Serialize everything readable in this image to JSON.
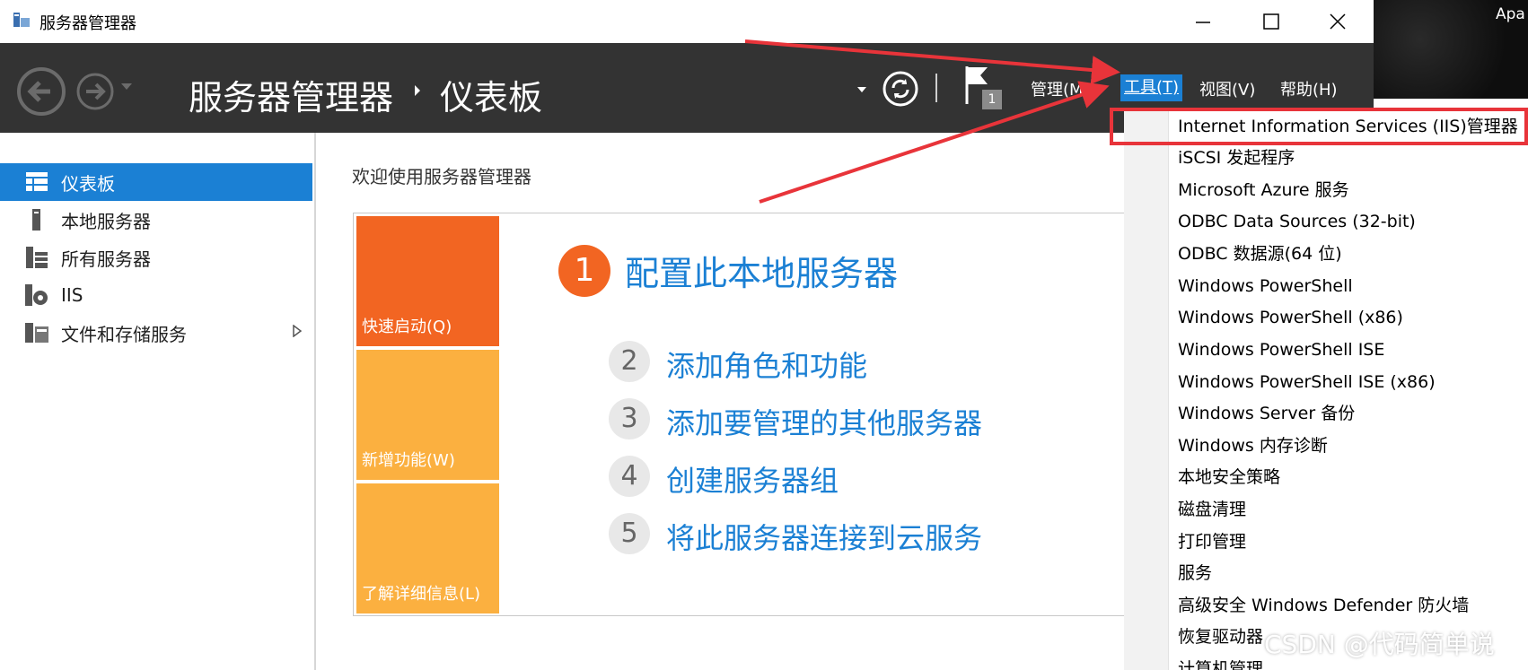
{
  "window": {
    "title": "服务器管理器",
    "corner_text": "Apa"
  },
  "header": {
    "breadcrumb_root": "服务器管理器",
    "breadcrumb_current": "仪表板",
    "notification_count": "1",
    "menus": {
      "manage": "管理(M)",
      "tools": "工具(T)",
      "view": "视图(V)",
      "help": "帮助(H)"
    }
  },
  "sidebar": {
    "items": [
      {
        "label": "仪表板",
        "icon": "dashboard-icon",
        "active": true
      },
      {
        "label": "本地服务器",
        "icon": "server-icon"
      },
      {
        "label": "所有服务器",
        "icon": "servers-icon"
      },
      {
        "label": "IIS",
        "icon": "iis-icon"
      },
      {
        "label": "文件和存储服务",
        "icon": "storage-icon",
        "expandable": true
      }
    ]
  },
  "main": {
    "welcome": "欢迎使用服务器管理器",
    "tiles": {
      "quick_start": "快速启动(Q)",
      "new_features": "新增功能(W)",
      "learn_more": "了解详细信息(L)"
    },
    "steps": [
      {
        "num": "1",
        "label": "配置此本地服务器"
      },
      {
        "num": "2",
        "label": "添加角色和功能"
      },
      {
        "num": "3",
        "label": "添加要管理的其他服务器"
      },
      {
        "num": "4",
        "label": "创建服务器组"
      },
      {
        "num": "5",
        "label": "将此服务器连接到云服务"
      }
    ]
  },
  "tools_menu": {
    "items": [
      "Internet Information Services (IIS)管理器",
      "iSCSI 发起程序",
      "Microsoft Azure 服务",
      "ODBC Data Sources (32-bit)",
      "ODBC 数据源(64 位)",
      "Windows PowerShell",
      "Windows PowerShell (x86)",
      "Windows PowerShell ISE",
      "Windows PowerShell ISE (x86)",
      "Windows Server 备份",
      "Windows 内存诊断",
      "本地安全策略",
      "磁盘清理",
      "打印管理",
      "服务",
      "高级安全 Windows Defender 防火墙",
      "恢复驱动器",
      "计算机管理"
    ],
    "highlighted_index": 0
  },
  "watermark": "CSDN @代码简单说",
  "colors": {
    "accent": "#1b80d4",
    "header_bg": "#333333",
    "tile_orange": "#f26522",
    "tile_amber": "#fbb040",
    "annotation_red": "#e8343a"
  }
}
